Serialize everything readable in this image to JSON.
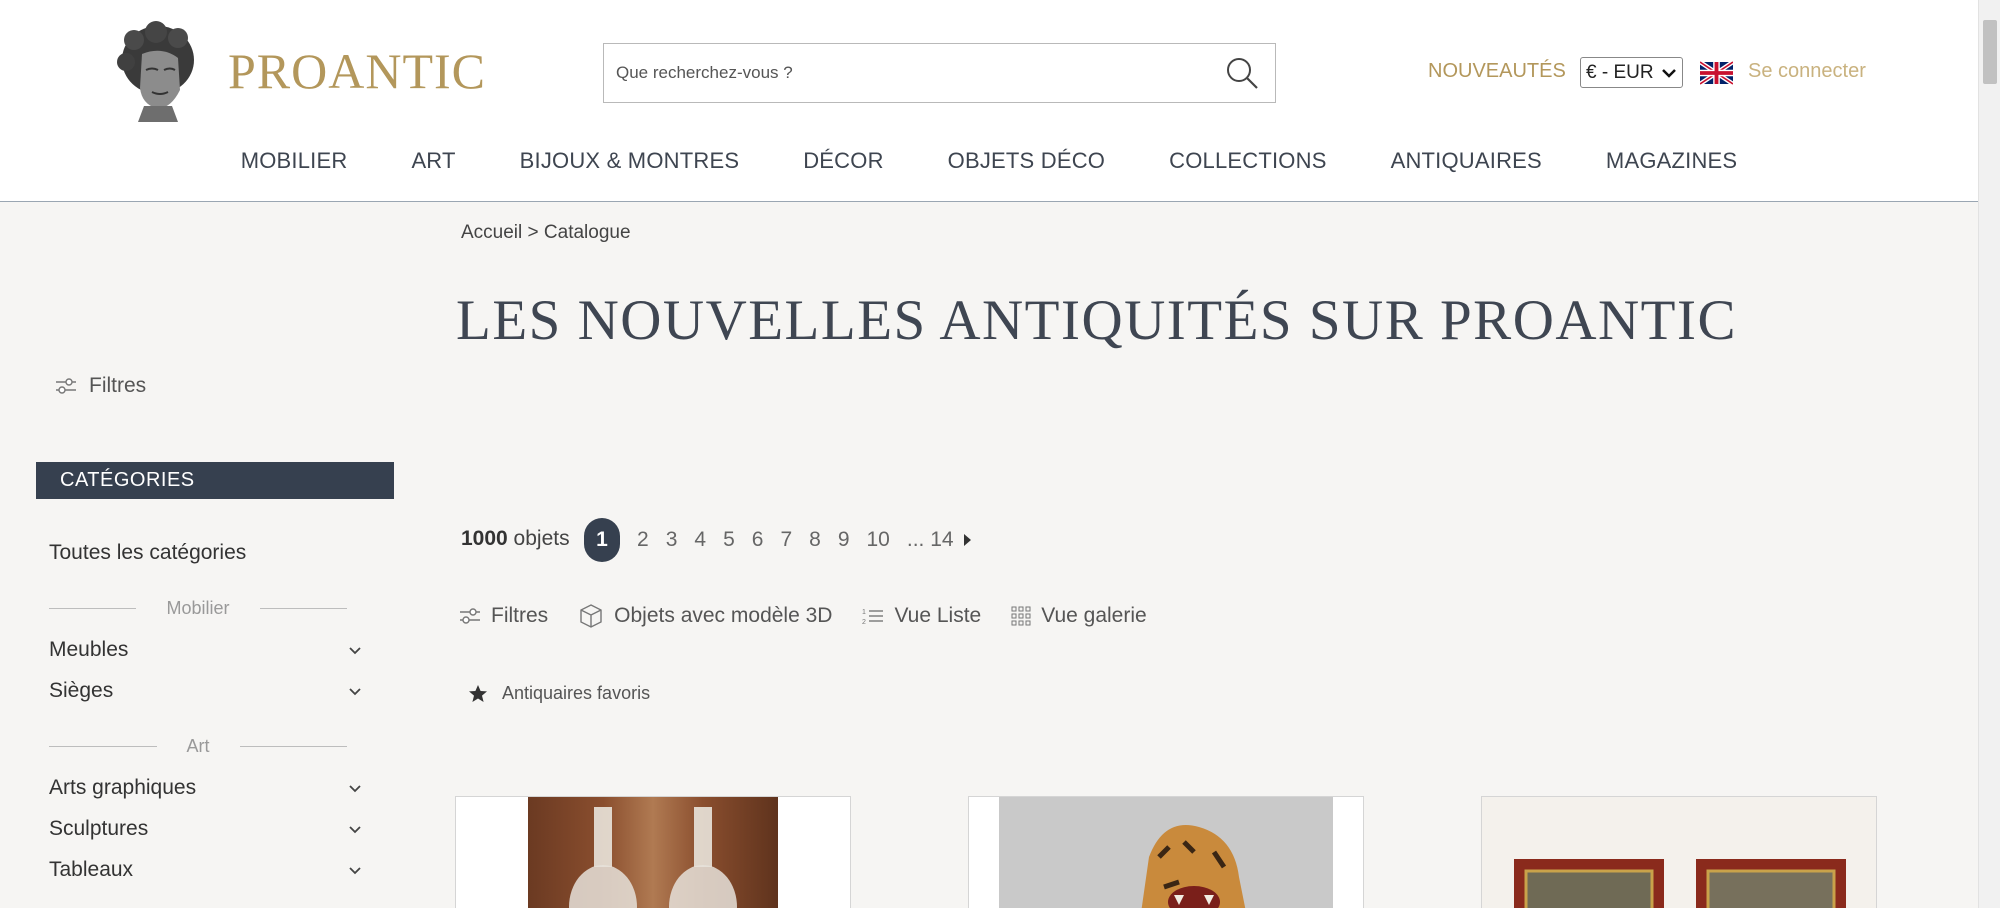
{
  "header": {
    "logo_text": "PROANTIC",
    "search_placeholder": "Que recherchez-vous ?",
    "nouveautes_label": "NOUVEAUTÉS",
    "currency_value": "€ - EUR",
    "login_label": "Se connecter",
    "accent_color": "#b3975b"
  },
  "nav": {
    "items": [
      {
        "label": "MOBILIER"
      },
      {
        "label": "ART"
      },
      {
        "label": "BIJOUX & MONTRES"
      },
      {
        "label": "DÉCOR"
      },
      {
        "label": "OBJETS DÉCO"
      },
      {
        "label": "COLLECTIONS"
      },
      {
        "label": "ANTIQUAIRES"
      },
      {
        "label": "MAGAZINES"
      }
    ]
  },
  "sidebar": {
    "filter_label": "Filtres",
    "categories_title": "CATÉGORIES",
    "all_categories": "Toutes les catégories",
    "groups": [
      {
        "label": "Mobilier",
        "items": [
          {
            "label": "Meubles"
          },
          {
            "label": "Sièges"
          }
        ]
      },
      {
        "label": "Art",
        "items": [
          {
            "label": "Arts graphiques"
          },
          {
            "label": "Sculptures"
          },
          {
            "label": "Tableaux"
          }
        ]
      }
    ]
  },
  "main": {
    "breadcrumb": {
      "home": "Accueil",
      "separator": " > ",
      "current": "Catalogue"
    },
    "title": "LES NOUVELLES ANTIQUITÉS SUR PROANTIC",
    "count_number": "1000",
    "count_unit": " objets",
    "pages": [
      "1",
      "2",
      "3",
      "4",
      "5",
      "6",
      "7",
      "8",
      "9",
      "10",
      "... 14"
    ],
    "current_page": "1",
    "toolbar": {
      "filters": "Filtres",
      "objects_3d": "Objets avec modèle 3D",
      "list_view": "Vue Liste",
      "gallery_view": "Vue galerie"
    },
    "favorites_label": "Antiquaires favoris"
  },
  "colors": {
    "dark_navy": "#36404f",
    "background": "#f6f5f3"
  }
}
